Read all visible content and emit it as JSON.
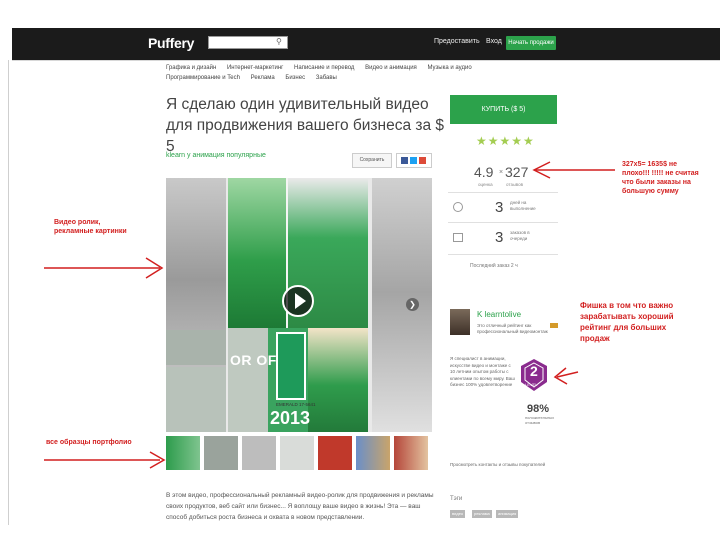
{
  "header": {
    "logo": "Puffery",
    "search_placeholder": "",
    "nav_sell": "Предоставить",
    "nav_login": "Вход",
    "join_label": "Начать продажи"
  },
  "categories": [
    "Графика и дизайн",
    "Интернет-маркетинг",
    "Написание и перевод",
    "Видео и анимация",
    "Музыка и аудио",
    "Программирование и Tech",
    "Реклама",
    "Бизнес",
    "Забавы"
  ],
  "gig": {
    "title": "Я сделаю один удивительный видео для продвижения вашего бизнеса за $ 5",
    "seller_line": "klearn у анимация популярные",
    "save_label": "Сохранить",
    "media_caption": "OR OF",
    "swatch_text": "EMERALD 17-5641",
    "year": "2013",
    "description": "В этом видео, профессиональный рекламный видео-ролик для продвижения и рекламы своих продуктов, веб сайт или бизнес... Я воплощу ваше видео в жизнь! Эта — ваш способ добиться роста бизнеса и охвата в новом представлении."
  },
  "sidebar": {
    "buy_label": "КУПИТЬ ($ 5)",
    "stars": "★★★★★",
    "rating": "4.9",
    "rating_x": "×",
    "reviews": "327",
    "rating_label": "оценка",
    "reviews_label": "отзывов",
    "days_value": "3",
    "days_label": "дней на выполнение",
    "orders_value": "3",
    "orders_label": "заказов в очереди",
    "queue_text": "Последний заказ 2 ч",
    "seller_name": "K learntolive",
    "seller_info": "Это отличный рейтинг как профессиональный видеомонтаж",
    "seller_bio": "Я специалист в анимации, искусстве видео и монтаже с 10 летним опытом работы с клиентами по всему миру. Ваш бизнес 100% удовлетворение",
    "level": "2",
    "level_label": "LEVEL",
    "percent": "98%",
    "percent_label": "положительных отзывов",
    "contact": "Просмотреть контакты и отзывы покупателей",
    "tags_title": "Тэги",
    "tags": [
      "видео",
      "реклама",
      "анимация"
    ]
  },
  "annotations": {
    "video": "Видео ролик,\nрекламные картинки",
    "portfolio": "все образцы портфолио",
    "rating_note": "327х5= 1635$ не плохо!!! !!!!! не считая что были заказы на большую сумму",
    "level_note": "Фишка в том что важно зарабатывать хороший рейтинг для больших продаж"
  },
  "colors": {
    "brand_green": "#2ca24b",
    "annotation_red": "#d21f1f",
    "header_bg": "#1b1b1b",
    "level_purple": "#8a2b8e"
  },
  "icons": [
    "search-icon",
    "clock-icon",
    "orders-icon",
    "play-icon",
    "next-arrow-icon",
    "flag-icon"
  ]
}
